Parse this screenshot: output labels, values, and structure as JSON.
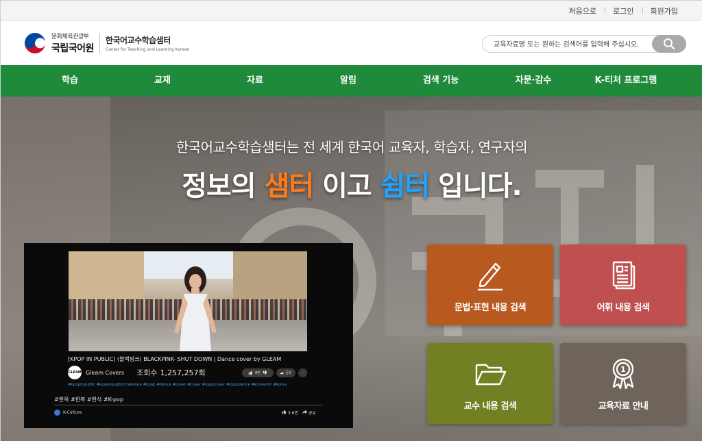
{
  "util_links": [
    "처음으로",
    "로그인",
    "회원가입"
  ],
  "logo": {
    "ministry": "문화체육관광부",
    "institute": "국립국어원",
    "center_kr": "한국어교수학습샘터",
    "center_en": "Center for Teaching and Learning Korean"
  },
  "search": {
    "placeholder": "교육자료명 또는 원하는 검색어를 입력해 주십시오.",
    "icon": "search-icon"
  },
  "nav": [
    "학습",
    "교재",
    "자료",
    "알림",
    "검색 기능",
    "자문·감수",
    "K-티처 프로그램"
  ],
  "hero": {
    "line1": "한국어교수학습샘터는 전 세계 한국어 교육자, 학습자, 연구자의",
    "line2_a": "정보의 ",
    "line2_b": "샘터",
    "line2_c": " 이고 ",
    "line2_d": "쉼터",
    "line2_e": " 입니다.",
    "accent_orange": "#ff7a1a",
    "accent_blue": "#1ea3ff"
  },
  "video": {
    "title": "[KPOP IN PUBLIC] (블랙핑크) BLACKPINK- SHUT DOWN | Dance cover by GLEAM",
    "channel_avatar": "GLEAM",
    "channel": "Gleam Covers",
    "views_label": "조회수",
    "views": "1,257,257회",
    "like_pill": "8만",
    "share_pill": "공유",
    "more_pill": "···",
    "hashtags": "#kpopinpublic #kpopinpublicchallenge #kpop #dance #cover #cover #kpopcover #kpopdance #kcoverist #korea",
    "tags": "#한옥   #한복   #한식   #K-pop",
    "source": "K-Culture",
    "likes": "3.6만",
    "share": "공유"
  },
  "tiles": [
    {
      "label": "문법·표현 내용 검색",
      "color": "#b85a1f",
      "icon": "pencil-icon"
    },
    {
      "label": "어휘 내용 검색",
      "color": "#c04f4f",
      "icon": "document-icon"
    },
    {
      "label": "교수 내용 검색",
      "color": "#727f22",
      "icon": "folder-icon"
    },
    {
      "label": "교육자료 안내",
      "color": "#6f645a",
      "icon": "award-icon"
    }
  ],
  "colors": {
    "nav_bg": "#1e8a3a"
  }
}
